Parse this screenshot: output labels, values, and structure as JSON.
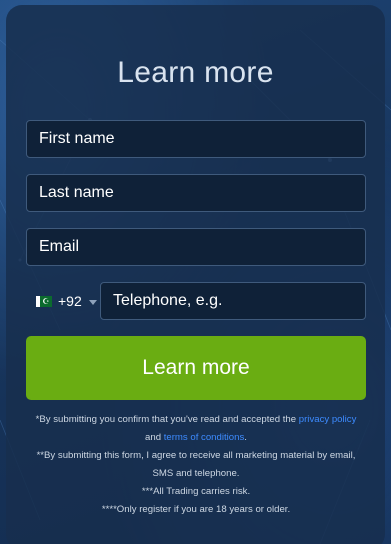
{
  "title": "Learn more",
  "form": {
    "first_name_placeholder": "First name",
    "last_name_placeholder": "Last name",
    "email_placeholder": "Email",
    "phone": {
      "country_flag": "pakistan-flag-icon",
      "dial_code": "+92",
      "placeholder": "Telephone, e.g."
    },
    "submit_label": "Learn more"
  },
  "disclaimer": {
    "line1_text": "*By submitting you confirm that you've read and accepted the ",
    "privacy_link": "privacy policy",
    "line2_and": "and ",
    "terms_link": "terms of conditions",
    "line2_end": ".",
    "line3": "**By submitting this form, I agree to receive all marketing material by email, SMS and telephone.",
    "line4": "***All Trading carries risk.",
    "line5": "****Only register if you are 18 years or older."
  },
  "colors": {
    "accent_green": "#6aad12",
    "link_blue": "#3d8bff",
    "background": "#1b3a63"
  }
}
